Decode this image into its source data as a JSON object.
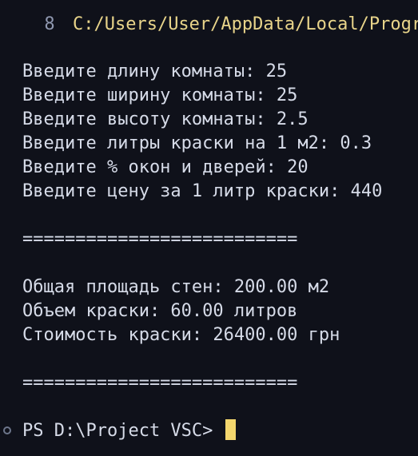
{
  "terminal": {
    "top_marker": "8",
    "top_path": "C:/Users/User/AppData/Local/Progra",
    "inputs": [
      {
        "text": "Введите длину комнаты: 25"
      },
      {
        "text": "Введите ширину комнаты: 25"
      },
      {
        "text": "Введите высоту комнаты: 2.5"
      },
      {
        "text": "Введите литры краски на 1 м2: 0.3"
      },
      {
        "text": "Введите % окон и дверей: 20"
      },
      {
        "text": "Введите цену за 1 литр краски: 440"
      }
    ],
    "separator_1": "==========================",
    "results": [
      {
        "text": "Общая площадь стен: 200.00 м2"
      },
      {
        "text": "Объем краски: 60.00 литров"
      },
      {
        "text": "Стоимость краски: 26400.00 грн"
      }
    ],
    "separator_2": "==========================",
    "prompt": "PS D:\\Project VSC> "
  }
}
